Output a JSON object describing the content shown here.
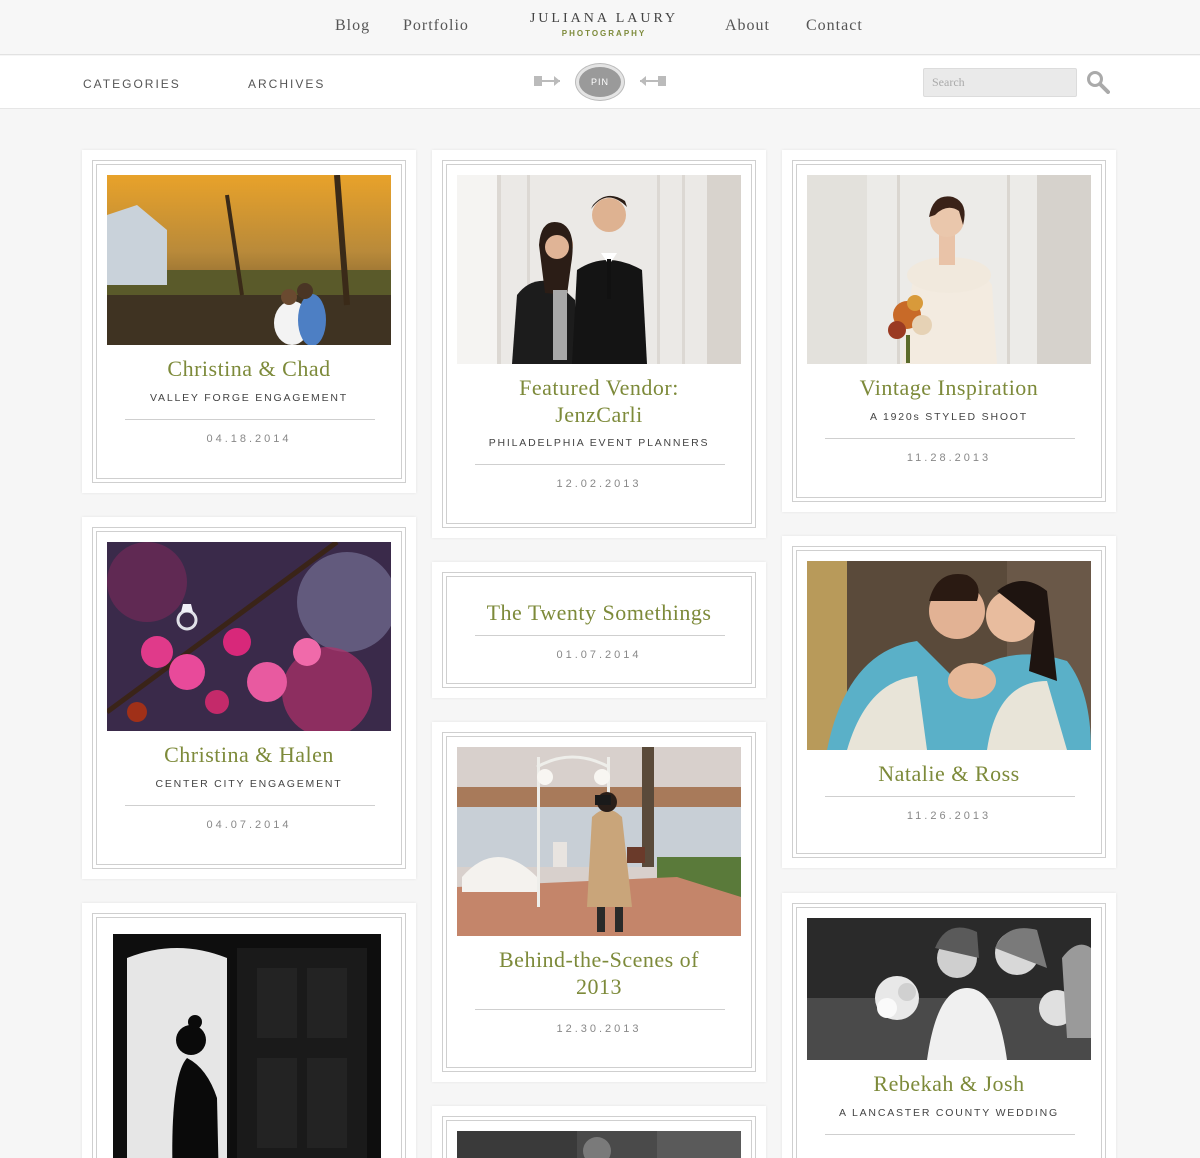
{
  "nav": {
    "blog": "Blog",
    "portfolio": "Portfolio",
    "logo_name": "JULIANA LAURY",
    "logo_sub": "PHOTOGRAPHY",
    "about": "About",
    "contact": "Contact"
  },
  "subnav": {
    "categories": "CATEGORIES",
    "archives": "ARCHIVES",
    "pin": "PIN",
    "search_placeholder": "Search"
  },
  "colors": {
    "accent_green": "#7d8a3a",
    "background": "#f6f6f6"
  },
  "posts": [
    {
      "title": "Christina & Chad",
      "subtitle": "VALLEY FORGE ENGAGEMENT",
      "date": "04.18.2014"
    },
    {
      "title": "Featured Vendor: JenzCarli",
      "subtitle": "PHILADELPHIA EVENT PLANNERS",
      "date": "12.02.2013"
    },
    {
      "title": "Vintage Inspiration",
      "subtitle": "A 1920s STYLED SHOOT",
      "date": "11.28.2013"
    },
    {
      "title": "Christina & Halen",
      "subtitle": "CENTER CITY ENGAGEMENT",
      "date": "04.07.2014"
    },
    {
      "title": "The Twenty Somethings",
      "subtitle": "",
      "date": "01.07.2014"
    },
    {
      "title": "Natalie & Ross",
      "subtitle": "",
      "date": "11.26.2013"
    },
    {
      "title": "Behind-the-Scenes of 2013",
      "subtitle": "",
      "date": "12.30.2013"
    },
    {
      "title": "Rebekah & Josh",
      "subtitle": "A LANCASTER COUNTY WEDDING",
      "date": ""
    }
  ]
}
